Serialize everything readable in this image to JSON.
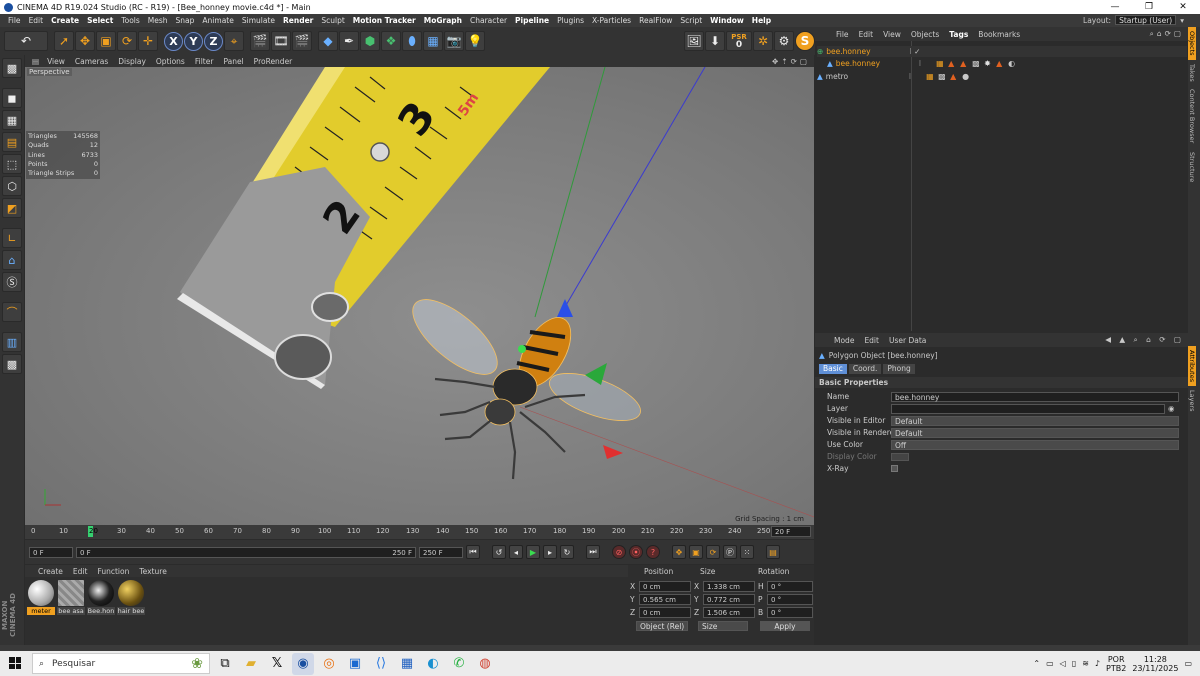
{
  "window": {
    "title": "CINEMA 4D R19.024 Studio (RC - R19) - [Bee_honney movie.c4d *] - Main",
    "min": "—",
    "max": "❐",
    "close": "✕"
  },
  "menubar": {
    "items": [
      "File",
      "Edit",
      "Create",
      "Select",
      "Tools",
      "Mesh",
      "Snap",
      "Animate",
      "Simulate",
      "Render",
      "Sculpt",
      "Motion Tracker",
      "MoGraph",
      "Character",
      "Pipeline",
      "Plugins",
      "X-Particles",
      "RealFlow",
      "Script",
      "Window",
      "Help"
    ],
    "layout_label": "Layout:",
    "layout_value": "Startup (User)"
  },
  "toolbar": {
    "axes": [
      "X",
      "Y",
      "Z"
    ],
    "psr_label": "PSR",
    "psr_value": "0"
  },
  "viewport": {
    "menu": [
      "View",
      "Cameras",
      "Display",
      "Options",
      "Filter",
      "Panel",
      "ProRender"
    ],
    "label": "Perspective",
    "grid_spacing": "Grid Spacing : 1 cm",
    "stats": [
      {
        "k": "Triangles",
        "v": "145568"
      },
      {
        "k": "Quads",
        "v": "12"
      },
      {
        "k": "Lines",
        "v": "6733"
      },
      {
        "k": "Points",
        "v": "0"
      },
      {
        "k": "Triangle Strips",
        "v": "0"
      }
    ],
    "tape": {
      "n2": "2",
      "n3": "3",
      "mark": "5m"
    }
  },
  "timeline": {
    "ticks": [
      "0",
      "10",
      "20",
      "30",
      "40",
      "50",
      "60",
      "70",
      "80",
      "90",
      "100",
      "110",
      "120",
      "130",
      "140",
      "150",
      "160",
      "170",
      "180",
      "190",
      "200",
      "210",
      "220",
      "230",
      "240",
      "250"
    ],
    "current_frame": "20",
    "current_frame_field": "20 F"
  },
  "transport": {
    "start": "0 F",
    "range_start": "0 F",
    "range_end": "250 F",
    "end": "250 F"
  },
  "materials": {
    "menu": [
      "Create",
      "Edit",
      "Function",
      "Texture"
    ],
    "items": [
      "meter",
      "bee asa",
      "Bee.hon",
      "hair bee"
    ],
    "maxon_logo": "MAXON CINEMA 4D"
  },
  "coordinates": {
    "headers": [
      "Position",
      "Size",
      "Rotation"
    ],
    "rows": [
      {
        "axis": "X",
        "pos": "0 cm",
        "size_axis": "X",
        "size": "1.338 cm",
        "rot_axis": "H",
        "rot": "0 °"
      },
      {
        "axis": "Y",
        "pos": "0.565 cm",
        "size_axis": "Y",
        "size": "0.772 cm",
        "rot_axis": "P",
        "rot": "0 °"
      },
      {
        "axis": "Z",
        "pos": "0 cm",
        "size_axis": "Z",
        "size": "1.506 cm",
        "rot_axis": "B",
        "rot": "0 °"
      }
    ],
    "mode": "Object (Rel)",
    "size_mode": "Size",
    "apply": "Apply"
  },
  "objects": {
    "menu": [
      "File",
      "Edit",
      "View",
      "Objects",
      "Tags",
      "Bookmarks"
    ],
    "items": [
      {
        "name": "bee.honney",
        "color": "#f0a020"
      },
      {
        "name": "bee.honney",
        "color": "#f0a020"
      },
      {
        "name": "metro",
        "color": "#c8c8c8"
      }
    ]
  },
  "attributes": {
    "menu": [
      "Mode",
      "Edit",
      "User Data"
    ],
    "object_title": "Polygon Object [bee.honney]",
    "tabs": [
      "Basic",
      "Coord.",
      "Phong"
    ],
    "section": "Basic Properties",
    "fields": [
      {
        "label": "Name",
        "value": "bee.honney"
      },
      {
        "label": "Layer",
        "value": ""
      },
      {
        "label": "Visible in Editor",
        "value": "Default"
      },
      {
        "label": "Visible in Renderer",
        "value": "Default"
      },
      {
        "label": "Use Color",
        "value": "Off"
      },
      {
        "label": "Display Color",
        "value": ""
      },
      {
        "label": "X-Ray",
        "value": ""
      }
    ]
  },
  "right_tabs": [
    "Objects",
    "Takes",
    "Content Browser",
    "Structure",
    "Attributes",
    "Layers"
  ],
  "taskbar": {
    "search_placeholder": "Pesquisar",
    "lang": "POR",
    "lang2": "PTB2",
    "time": "11:28",
    "date": "23/11/2025"
  }
}
